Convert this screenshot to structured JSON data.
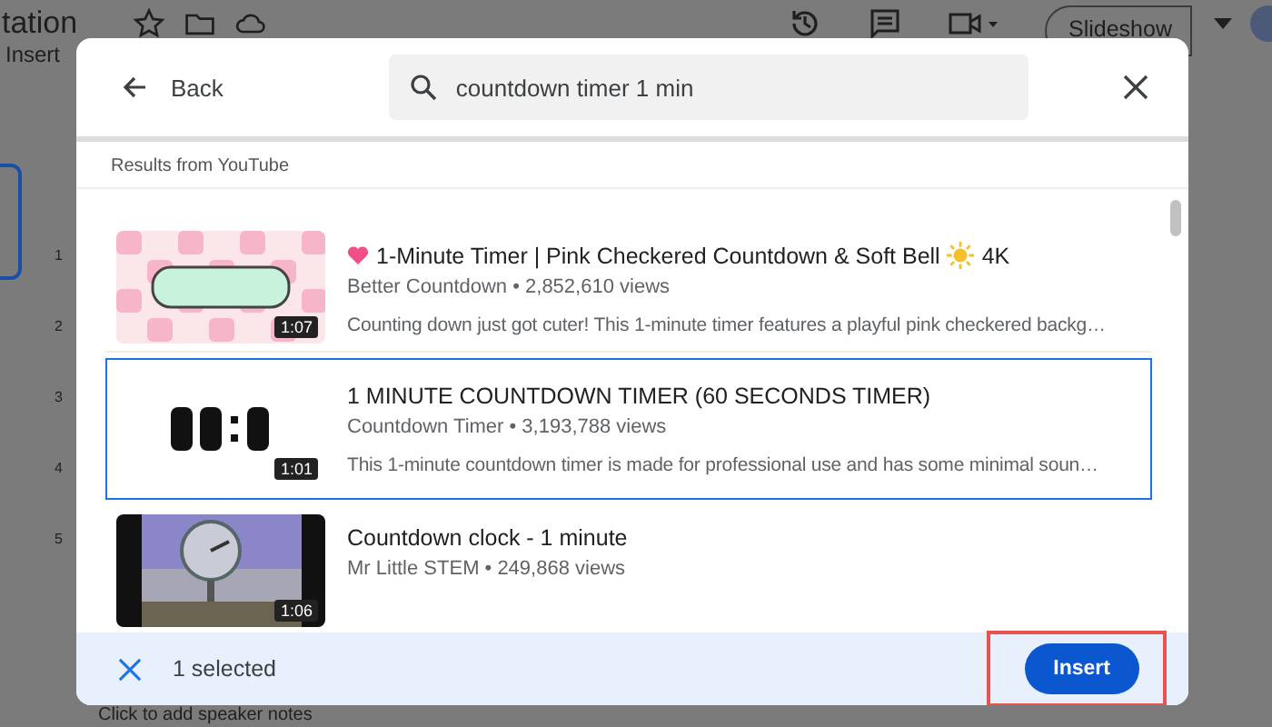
{
  "app": {
    "doc_title": "tation",
    "menu": [
      "Insert"
    ],
    "slideshow": "Slideshow",
    "ruler": [
      "1",
      "2",
      "3",
      "4",
      "5"
    ],
    "notes": "Click to add speaker notes"
  },
  "dialog": {
    "back": "Back",
    "search": {
      "value": "countdown timer 1 min"
    },
    "section": "Results from YouTube",
    "results": [
      {
        "kind": "picture",
        "decorated": true,
        "title": "1-Minute Timer | Pink Checkered Countdown & Soft Bell",
        "title_suffix": "4K",
        "byline": "Better Countdown • 2,852,610 views",
        "description": "Counting down just got cuter! This 1-minute timer features a playful pink checkered backg…",
        "duration": "1:07",
        "selected": false
      },
      {
        "kind": "picture",
        "title": "1 MINUTE COUNTDOWN TIMER (60 SECONDS TIMER)",
        "byline": "Countdown Timer • 3,193,788 views",
        "description": "This 1-minute countdown timer is made for professional use and has some minimal soun…",
        "duration": "1:01",
        "selected": true
      },
      {
        "kind": "picture",
        "title": "Countdown clock - 1 minute",
        "byline": "Mr Little STEM • 249,868 views",
        "duration": "1:06",
        "selected": false
      }
    ],
    "footer": {
      "count": "1 selected",
      "insert": "Insert"
    }
  }
}
